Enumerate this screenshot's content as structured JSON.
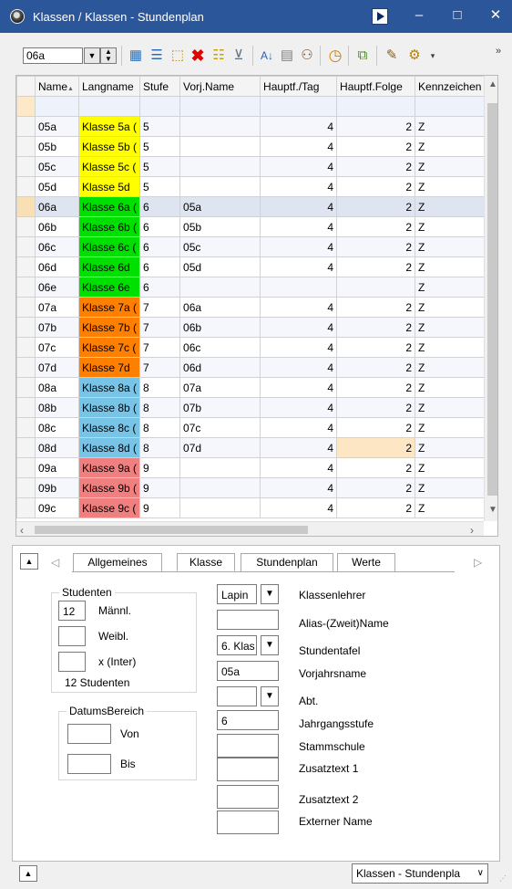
{
  "window": {
    "title": "Klassen / Klassen - Stundenplan",
    "minimize_glyph": "–",
    "maximize_glyph": "□",
    "close_glyph": "✕"
  },
  "toolbar": {
    "combo_value": "06a",
    "icons": [
      "grid-edit-icon",
      "list-icon",
      "new-record-icon",
      "delete-icon",
      "list-check-icon",
      "filter-icon",
      "sort-icon",
      "table-icon",
      "users-icon",
      "clock-icon",
      "copy-icon",
      "pen-icon",
      "settings-icon"
    ],
    "overflow_glyph": "»"
  },
  "grid": {
    "columns": [
      "Name",
      "Langname",
      "Stufe",
      "Vorj.Name",
      "Hauptf./Tag",
      "Hauptf.Folge",
      "Kennzeichen"
    ],
    "sort_indicator": "▲",
    "rows": [
      {
        "name": "05a",
        "lang": "Klasse 5a (",
        "stufe": "5",
        "vorj": "",
        "tag": "4",
        "folge": "2",
        "kz": "Z"
      },
      {
        "name": "05b",
        "lang": "Klasse 5b (",
        "stufe": "5",
        "vorj": "",
        "tag": "4",
        "folge": "2",
        "kz": "Z"
      },
      {
        "name": "05c",
        "lang": "Klasse 5c (",
        "stufe": "5",
        "vorj": "",
        "tag": "4",
        "folge": "2",
        "kz": "Z"
      },
      {
        "name": "05d",
        "lang": "Klasse 5d",
        "stufe": "5",
        "vorj": "",
        "tag": "4",
        "folge": "2",
        "kz": "Z"
      },
      {
        "name": "06a",
        "lang": "Klasse 6a (",
        "stufe": "6",
        "vorj": "05a",
        "tag": "4",
        "folge": "2",
        "kz": "Z"
      },
      {
        "name": "06b",
        "lang": "Klasse 6b (",
        "stufe": "6",
        "vorj": "05b",
        "tag": "4",
        "folge": "2",
        "kz": "Z"
      },
      {
        "name": "06c",
        "lang": "Klasse 6c (",
        "stufe": "6",
        "vorj": "05c",
        "tag": "4",
        "folge": "2",
        "kz": "Z"
      },
      {
        "name": "06d",
        "lang": "Klasse 6d",
        "stufe": "6",
        "vorj": "05d",
        "tag": "4",
        "folge": "2",
        "kz": "Z"
      },
      {
        "name": "06e",
        "lang": "Klasse 6e",
        "stufe": "6",
        "vorj": "",
        "tag": "",
        "folge": "",
        "kz": "Z"
      },
      {
        "name": "07a",
        "lang": "Klasse 7a (",
        "stufe": "7",
        "vorj": "06a",
        "tag": "4",
        "folge": "2",
        "kz": "Z"
      },
      {
        "name": "07b",
        "lang": "Klasse 7b (",
        "stufe": "7",
        "vorj": "06b",
        "tag": "4",
        "folge": "2",
        "kz": "Z"
      },
      {
        "name": "07c",
        "lang": "Klasse 7c (",
        "stufe": "7",
        "vorj": "06c",
        "tag": "4",
        "folge": "2",
        "kz": "Z"
      },
      {
        "name": "07d",
        "lang": "Klasse 7d",
        "stufe": "7",
        "vorj": "06d",
        "tag": "4",
        "folge": "2",
        "kz": "Z"
      },
      {
        "name": "08a",
        "lang": "Klasse 8a (",
        "stufe": "8",
        "vorj": "07a",
        "tag": "4",
        "folge": "2",
        "kz": "Z"
      },
      {
        "name": "08b",
        "lang": "Klasse 8b (",
        "stufe": "8",
        "vorj": "07b",
        "tag": "4",
        "folge": "2",
        "kz": "Z"
      },
      {
        "name": "08c",
        "lang": "Klasse 8c (",
        "stufe": "8",
        "vorj": "07c",
        "tag": "4",
        "folge": "2",
        "kz": "Z"
      },
      {
        "name": "08d",
        "lang": "Klasse 8d (",
        "stufe": "8",
        "vorj": "07d",
        "tag": "4",
        "folge": "2",
        "kz": "Z"
      },
      {
        "name": "09a",
        "lang": "Klasse 9a (",
        "stufe": "9",
        "vorj": "",
        "tag": "4",
        "folge": "2",
        "kz": "Z"
      },
      {
        "name": "09b",
        "lang": "Klasse 9b (",
        "stufe": "9",
        "vorj": "",
        "tag": "4",
        "folge": "2",
        "kz": "Z"
      },
      {
        "name": "09c",
        "lang": "Klasse 9c (",
        "stufe": "9",
        "vorj": "",
        "tag": "4",
        "folge": "2",
        "kz": "Z"
      }
    ],
    "colors": {
      "yellow": "#ffff00",
      "green": "#00e000",
      "orange": "#ff8000",
      "blue": "#78c4e6",
      "red": "#f08080"
    }
  },
  "tabs": [
    "Allgemeines",
    "Klasse",
    "Stundenplan",
    "Werte"
  ],
  "active_tab": "Klasse",
  "form": {
    "studenten_group": "Studenten",
    "maennl_value": "12",
    "maennl_label": "Männl.",
    "weibl_value": "",
    "weibl_label": "Weibl.",
    "inter_value": "",
    "inter_label": "x (Inter)",
    "studenten_total": "12 Studenten",
    "datum_group": "DatumsBereich",
    "von_value": "",
    "von_label": "Von",
    "bis_value": "",
    "bis_label": "Bis",
    "klassenlehrer_value": "Lapin",
    "klassenlehrer_label": "Klassenlehrer",
    "alias_value": "",
    "alias_label": "Alias-(Zweit)Name",
    "stundentafel_value": "6. Klas",
    "stundentafel_label": "Stundentafel",
    "vorjahr_value": "05a",
    "vorjahr_label": "Vorjahrsname",
    "abt_value": "",
    "abt_label": "Abt.",
    "jahrgang_value": "6",
    "jahrgang_label": "Jahrgangsstufe",
    "stammschule_value": "",
    "stammschule_label": "Stammschule",
    "zusatz1_value": "",
    "zusatz1_label": "Zusatztext 1",
    "zusatz2_value": "",
    "zusatz2_label": "Zusatztext 2",
    "extern_value": "",
    "extern_label": "Externer Name"
  },
  "status": {
    "view_select": "Klassen - Stundenpla"
  }
}
